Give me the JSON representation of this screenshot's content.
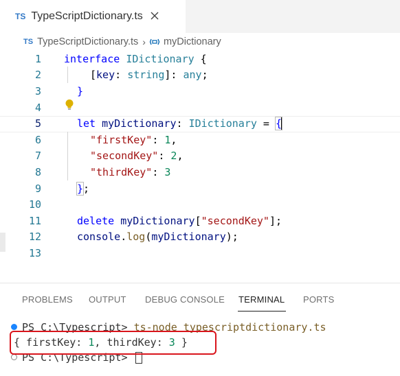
{
  "tab": {
    "badge": "TS",
    "label": "TypeScriptDictionary.ts"
  },
  "breadcrumb": {
    "badge": "TS",
    "file": "TypeScriptDictionary.ts",
    "symbol": "myDictionary"
  },
  "editor": {
    "active_line": 5,
    "line_numbers": [
      "1",
      "2",
      "3",
      "4",
      "5",
      "6",
      "7",
      "8",
      "9",
      "10",
      "11",
      "12",
      "13"
    ],
    "code": {
      "l1": {
        "kw": "interface",
        "type": "IDictionary",
        "rest": " {"
      },
      "l2": {
        "open": "[",
        "key": "key",
        "colon": ": ",
        "type": "string",
        "close": "]: ",
        "any": "any",
        "semi": ";"
      },
      "l3": {
        "brace": "}"
      },
      "l5": {
        "kw": "let",
        "var": "myDictionary",
        "colon": ": ",
        "type": "IDictionary",
        "eq": " = ",
        "brace": "{"
      },
      "l6": {
        "key": "\"firstKey\"",
        "colon": ": ",
        "val": "1",
        "comma": ","
      },
      "l7": {
        "key": "\"secondKey\"",
        "colon": ": ",
        "val": "2",
        "comma": ","
      },
      "l8": {
        "key": "\"thirdKey\"",
        "colon": ": ",
        "val": "3"
      },
      "l9": {
        "brace": "}",
        "semi": ";"
      },
      "l11": {
        "kw": "delete",
        "var": "myDictionary",
        "open": "[",
        "str": "\"secondKey\"",
        "close": "];"
      },
      "l12": {
        "obj": "console",
        "dot": ".",
        "fn": "log",
        "open": "(",
        "var": "myDictionary",
        "close": ");"
      }
    }
  },
  "panel": {
    "tabs": [
      "PROBLEMS",
      "OUTPUT",
      "DEBUG CONSOLE",
      "TERMINAL",
      "PORTS"
    ],
    "active_tab": "TERMINAL"
  },
  "terminal": {
    "prompt1": "PS C:\\Typescript> ",
    "command": "ts-node typescriptdictionary.ts",
    "output_open": "{ firstKey: ",
    "output_v1": "1",
    "output_mid": ", thirdKey: ",
    "output_v2": "3",
    "output_close": " }",
    "prompt2": "PS C:\\Typescript> "
  },
  "colors": {
    "highlight_box": "#d9141b",
    "ts_blue": "#3178c6",
    "keyword": "#0000ff",
    "type": "#267f99",
    "string": "#a31515",
    "number": "#098658"
  }
}
